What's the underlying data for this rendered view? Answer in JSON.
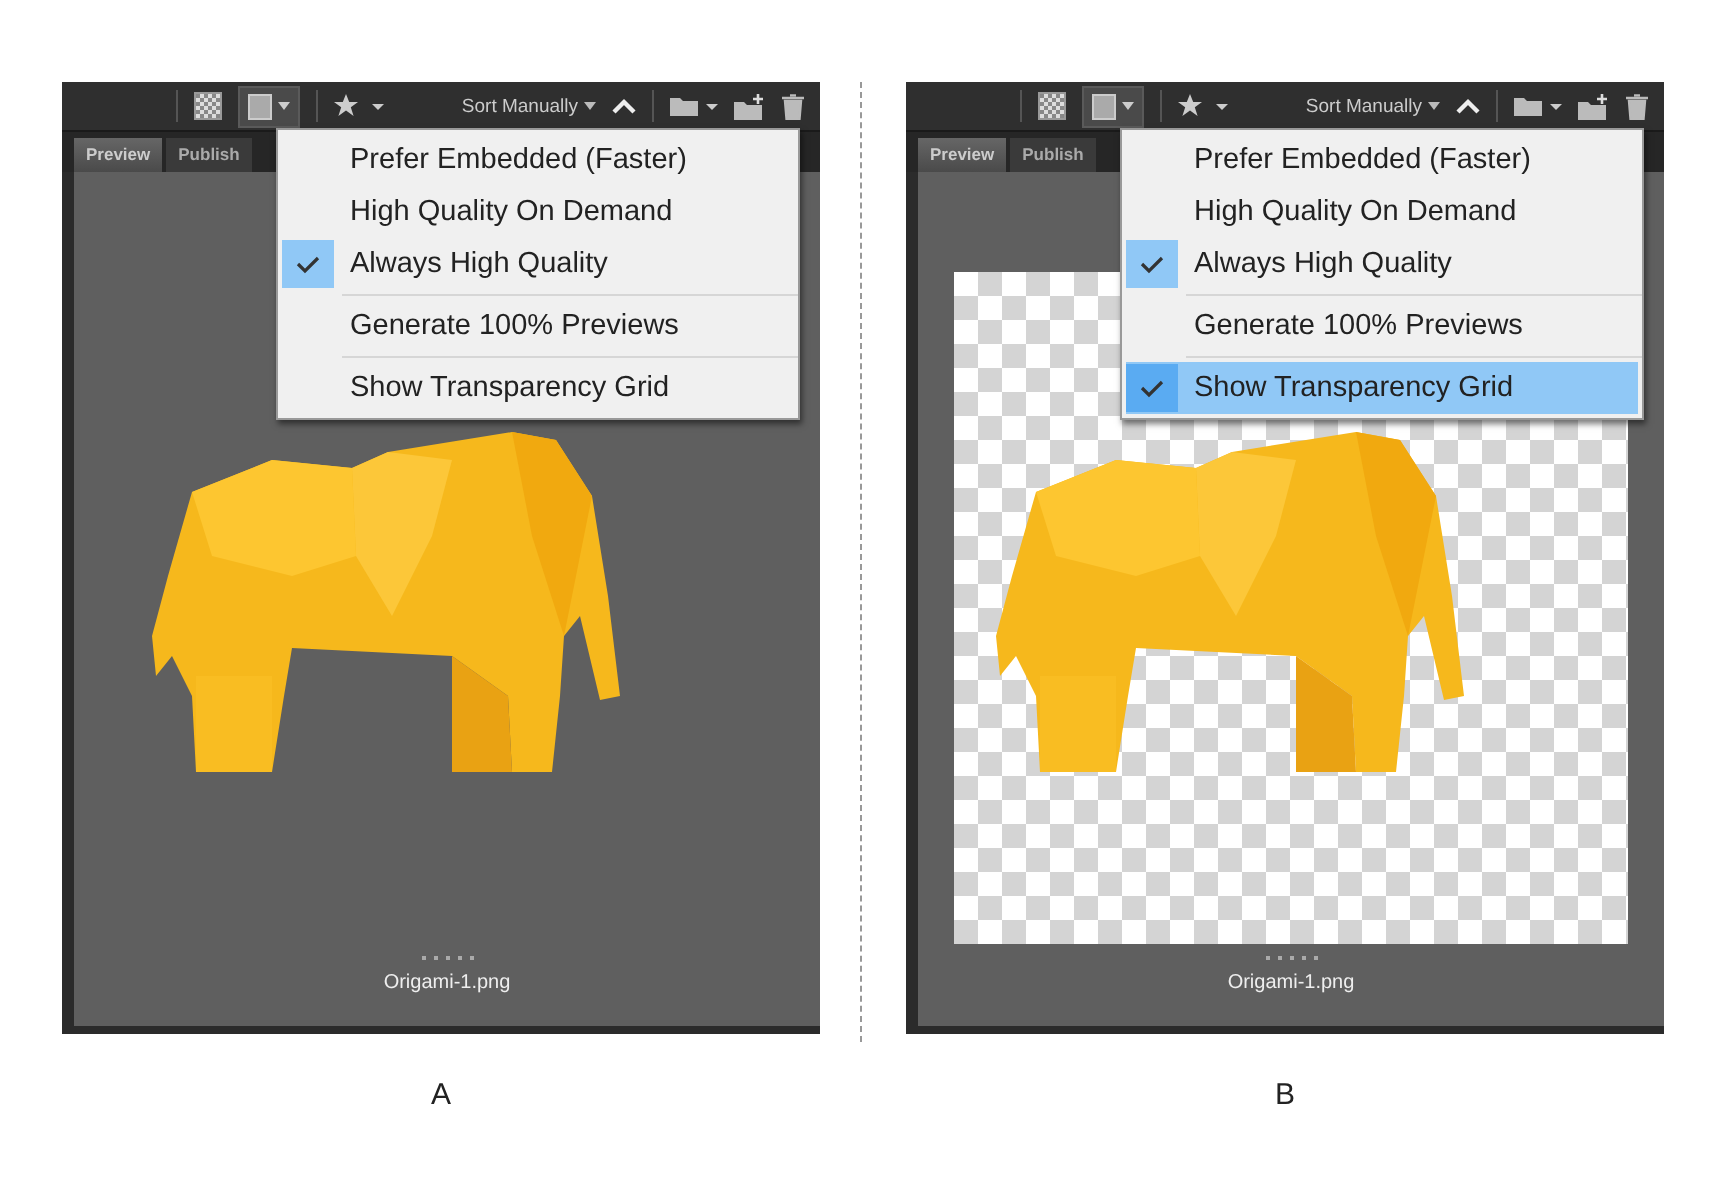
{
  "panels": [
    {
      "toolbar": {
        "sort_label": "Sort Manually"
      },
      "tabs": [
        {
          "label": "Preview",
          "selected": true
        },
        {
          "label": "Publish",
          "selected": false
        }
      ],
      "menu": {
        "groups": [
          [
            {
              "label": "Prefer Embedded (Faster)",
              "checked": false,
              "selected": false
            },
            {
              "label": "High Quality On Demand",
              "checked": false,
              "selected": false
            },
            {
              "label": "Always High Quality",
              "checked": true,
              "selected": false
            }
          ],
          [
            {
              "label": "Generate 100% Previews",
              "checked": false,
              "selected": false
            }
          ],
          [
            {
              "label": "Show Transparency Grid",
              "checked": false,
              "selected": false
            }
          ]
        ]
      },
      "preview": {
        "transparency_grid": false,
        "filename": "Origami-1.png"
      },
      "caption": "A"
    },
    {
      "toolbar": {
        "sort_label": "Sort Manually"
      },
      "tabs": [
        {
          "label": "Preview",
          "selected": true
        },
        {
          "label": "Publish",
          "selected": false
        }
      ],
      "menu": {
        "groups": [
          [
            {
              "label": "Prefer Embedded (Faster)",
              "checked": false,
              "selected": false
            },
            {
              "label": "High Quality On Demand",
              "checked": false,
              "selected": false
            },
            {
              "label": "Always High Quality",
              "checked": true,
              "selected": false
            }
          ],
          [
            {
              "label": "Generate 100% Previews",
              "checked": false,
              "selected": false
            }
          ],
          [
            {
              "label": "Show Transparency Grid",
              "checked": true,
              "selected": true
            }
          ]
        ]
      },
      "preview": {
        "transparency_grid": true,
        "filename": "Origami-1.png"
      },
      "caption": "B"
    }
  ]
}
